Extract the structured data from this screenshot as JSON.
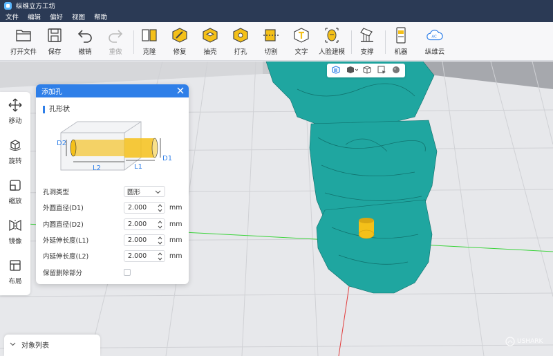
{
  "app": {
    "title": "纵维立方工坊"
  },
  "menu": [
    "文件",
    "编辑",
    "偏好",
    "视图",
    "帮助"
  ],
  "toolbar": {
    "open": "打开文件",
    "save": "保存",
    "undo": "撤销",
    "redo": "重做",
    "clone": "克隆",
    "repair": "修复",
    "hollow": "抽壳",
    "punch": "打孔",
    "cut": "切割",
    "text": "文字",
    "face": "人脸建模",
    "support": "支撑",
    "machine": "机器",
    "cloud": "纵维云"
  },
  "leftbar": {
    "move": "移动",
    "rotate": "旋转",
    "scale": "缩放",
    "mirror": "镜像",
    "layout": "布局"
  },
  "dialog": {
    "title": "添加孔",
    "section": "孔形状",
    "diagram_labels": {
      "d1": "D1",
      "d2": "D2",
      "l1": "L1",
      "l2": "L2"
    },
    "hole_type_label": "孔洞类型",
    "hole_type_value": "圆形",
    "outer_diameter_label": "外圆直径(D1)",
    "outer_diameter_value": "2.000",
    "inner_diameter_label": "内圆直径(D2)",
    "inner_diameter_value": "2.000",
    "outer_ext_label": "外延伸长度(L1)",
    "outer_ext_value": "2.000",
    "inner_ext_label": "内延伸长度(L2)",
    "inner_ext_value": "2.000",
    "unit": "mm",
    "keep_removed_label": "保留删除部分",
    "keep_removed_checked": false
  },
  "object_list": {
    "title": "对象列表"
  },
  "watermark": "USHARK",
  "colors": {
    "accent": "#2f7fe8",
    "titlebar": "#2b3a55",
    "model": "#1fa6a0",
    "hole": "#f4c019"
  }
}
